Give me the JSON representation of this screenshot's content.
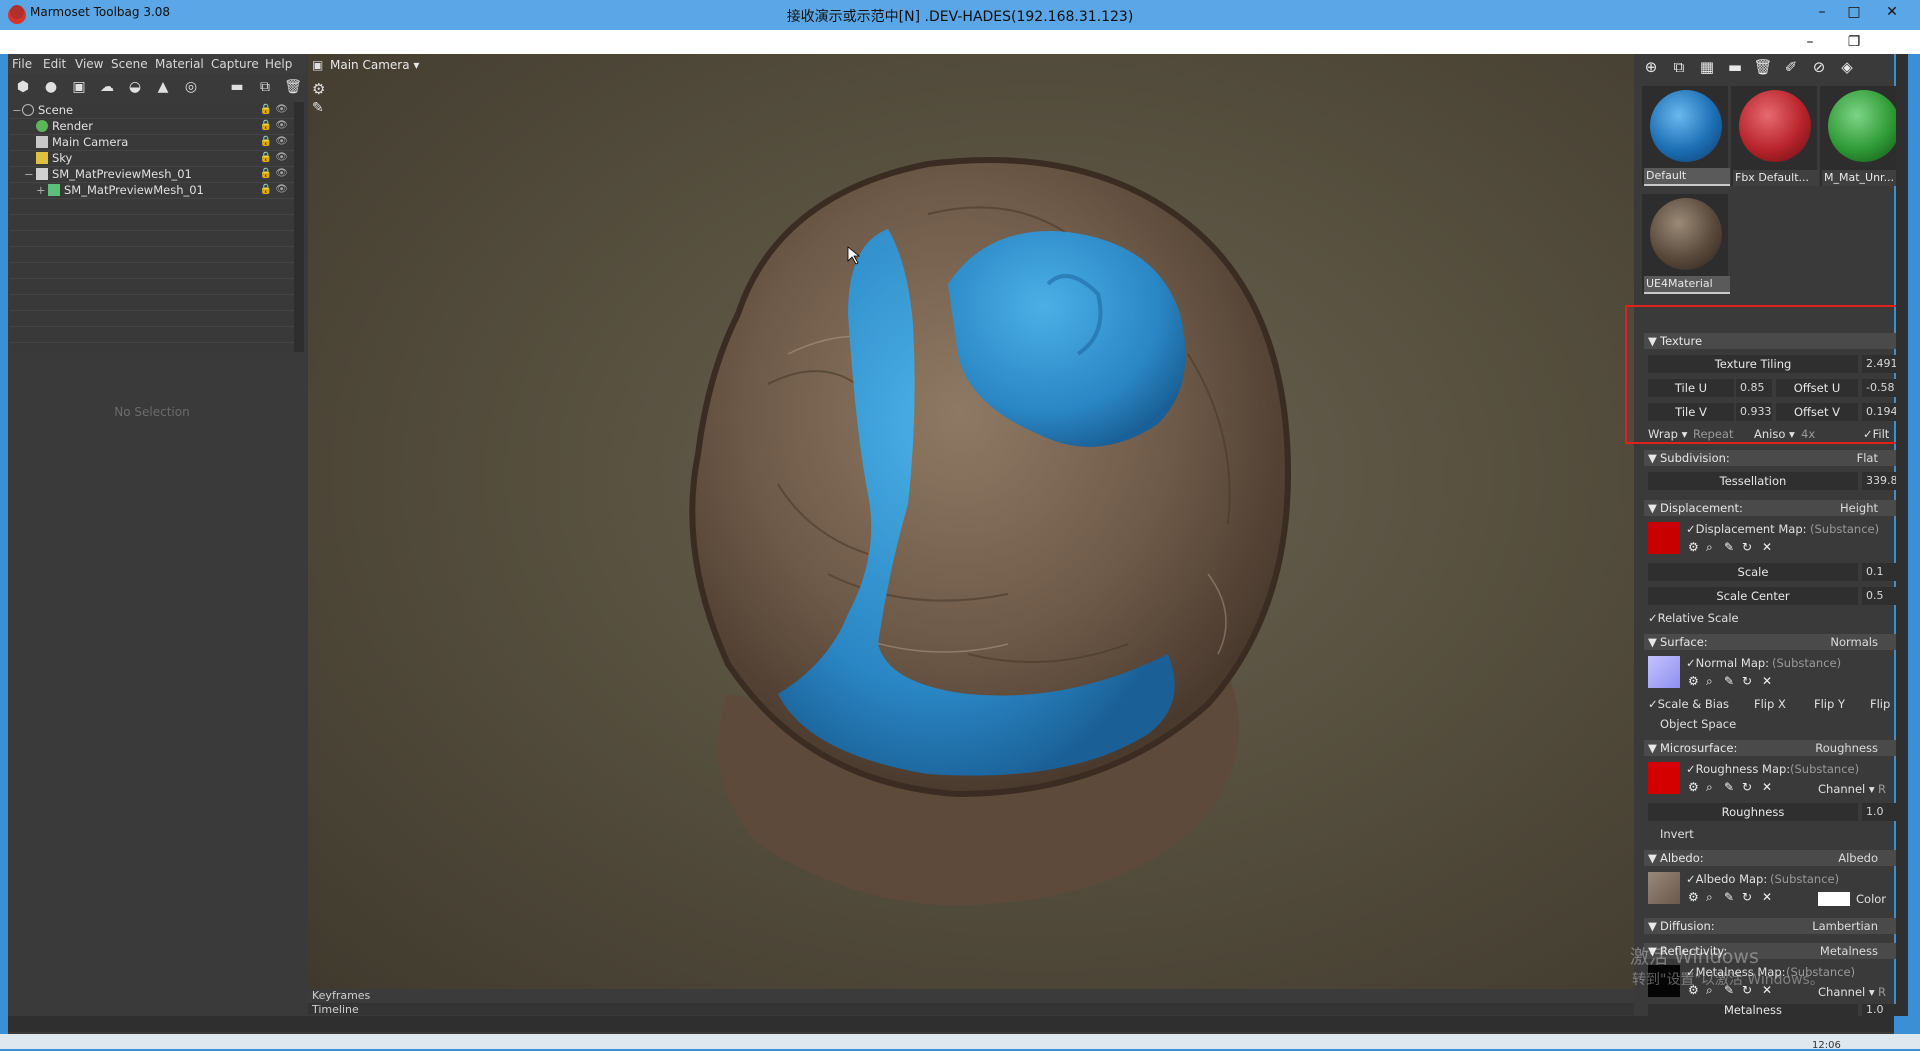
{
  "remote_window": {
    "title": "接收演示或示范中[N] .DEV-HADES(192.168.31.123)",
    "minimize": "–",
    "maximize": "□",
    "close": "✕"
  },
  "app": {
    "title": "Marmoset Toolbag 3.08",
    "restore": "❐",
    "minimize": "–"
  },
  "menubar": [
    "File",
    "Edit",
    "View",
    "Scene",
    "Material",
    "Capture",
    "Help"
  ],
  "toolbar_icons": [
    "cube-icon",
    "light-icon",
    "camera-icon",
    "sky-icon",
    "shadow-icon",
    "hat-icon",
    "sphere-icon",
    "folder-icon",
    "duplicate-icon",
    "trash-icon"
  ],
  "scene_tree": [
    {
      "label": "Scene",
      "icon": "scene-icon",
      "indent": 0
    },
    {
      "label": "Render",
      "icon": "render-icon",
      "indent": 1
    },
    {
      "label": "Main Camera",
      "icon": "camera-icon",
      "indent": 1
    },
    {
      "label": "Sky",
      "icon": "sky-icon",
      "indent": 1
    },
    {
      "label": "SM_MatPreviewMesh_01",
      "icon": "mesh-icon",
      "indent": 1
    },
    {
      "label": "SM_MatPreviewMesh_01",
      "icon": "mesh-icon",
      "indent": 2
    }
  ],
  "properties_empty": "No Selection",
  "viewport": {
    "camera_label": "Main Camera ▾",
    "keyframes": "Keyframes",
    "timeline": "Timeline"
  },
  "materials": [
    {
      "name": "Default",
      "color": "#1c6fb5"
    },
    {
      "name": "Fbx Default...",
      "color": "#b8232b"
    },
    {
      "name": "M_Mat_Unr...",
      "color": "#2f9a36"
    },
    {
      "name": "UE4Material",
      "color": "#5a4a3c"
    }
  ],
  "texture": {
    "header": "Texture",
    "tiling_label": "Texture Tiling",
    "tiling_value": "2.491",
    "tile_u_label": "Tile U",
    "tile_u_value": "0.85",
    "offset_u_label": "Offset U",
    "offset_u_value": "-0.58",
    "tile_v_label": "Tile V",
    "tile_v_value": "0.933",
    "offset_v_label": "Offset V",
    "offset_v_value": "0.194",
    "wrap_label": "Wrap ▾",
    "wrap_value": "Repeat",
    "aniso_label": "Aniso ▾",
    "aniso_value": "4x",
    "filter_label": "✓Filt"
  },
  "subdivision": {
    "header": "Subdivision:",
    "mode": "Flat",
    "tess_label": "Tessellation",
    "tess_value": "339.8"
  },
  "displacement": {
    "header": "Displacement:",
    "mode": "Height",
    "map_label": "✓Displacement Map:",
    "map_source": "(Substance)",
    "scale_label": "Scale",
    "scale_value": "0.1",
    "center_label": "Scale Center",
    "center_value": "0.5",
    "relative": "✓Relative Scale"
  },
  "surface": {
    "header": "Surface:",
    "mode": "Normals",
    "map_label": "✓Normal Map:",
    "map_source": "(Substance)",
    "scale_bias": "✓Scale & Bias",
    "flip_x": "Flip X",
    "flip_y": "Flip Y",
    "flip": "Flip",
    "object_space": "Object Space"
  },
  "microsurface": {
    "header": "Microsurface:",
    "mode": "Roughness",
    "map_label": "✓Roughness Map:",
    "map_source": "(Substance)",
    "channel_label": "Channel ▾",
    "channel_value": "R",
    "roughness_label": "Roughness",
    "roughness_value": "1.0",
    "invert": "Invert"
  },
  "albedo": {
    "header": "Albedo:",
    "mode": "Albedo",
    "map_label": "✓Albedo Map:",
    "map_source": "(Substance)",
    "color_label": "Color"
  },
  "diffusion": {
    "header": "Diffusion:",
    "mode": "Lambertian"
  },
  "reflectivity": {
    "header": "Reflectivity:",
    "mode": "Metalness",
    "map_label": "✓Metalness Map:",
    "map_source": "(Substance)",
    "channel_label": "Channel ▾",
    "channel_value": "R",
    "metalness_label": "Metalness",
    "metalness_value": "1.0"
  },
  "watermark": {
    "line1": "激活 Windows",
    "line2": "转到\"设置\"以激活 Windows。"
  },
  "taskbar": {
    "clock": "12:06"
  }
}
